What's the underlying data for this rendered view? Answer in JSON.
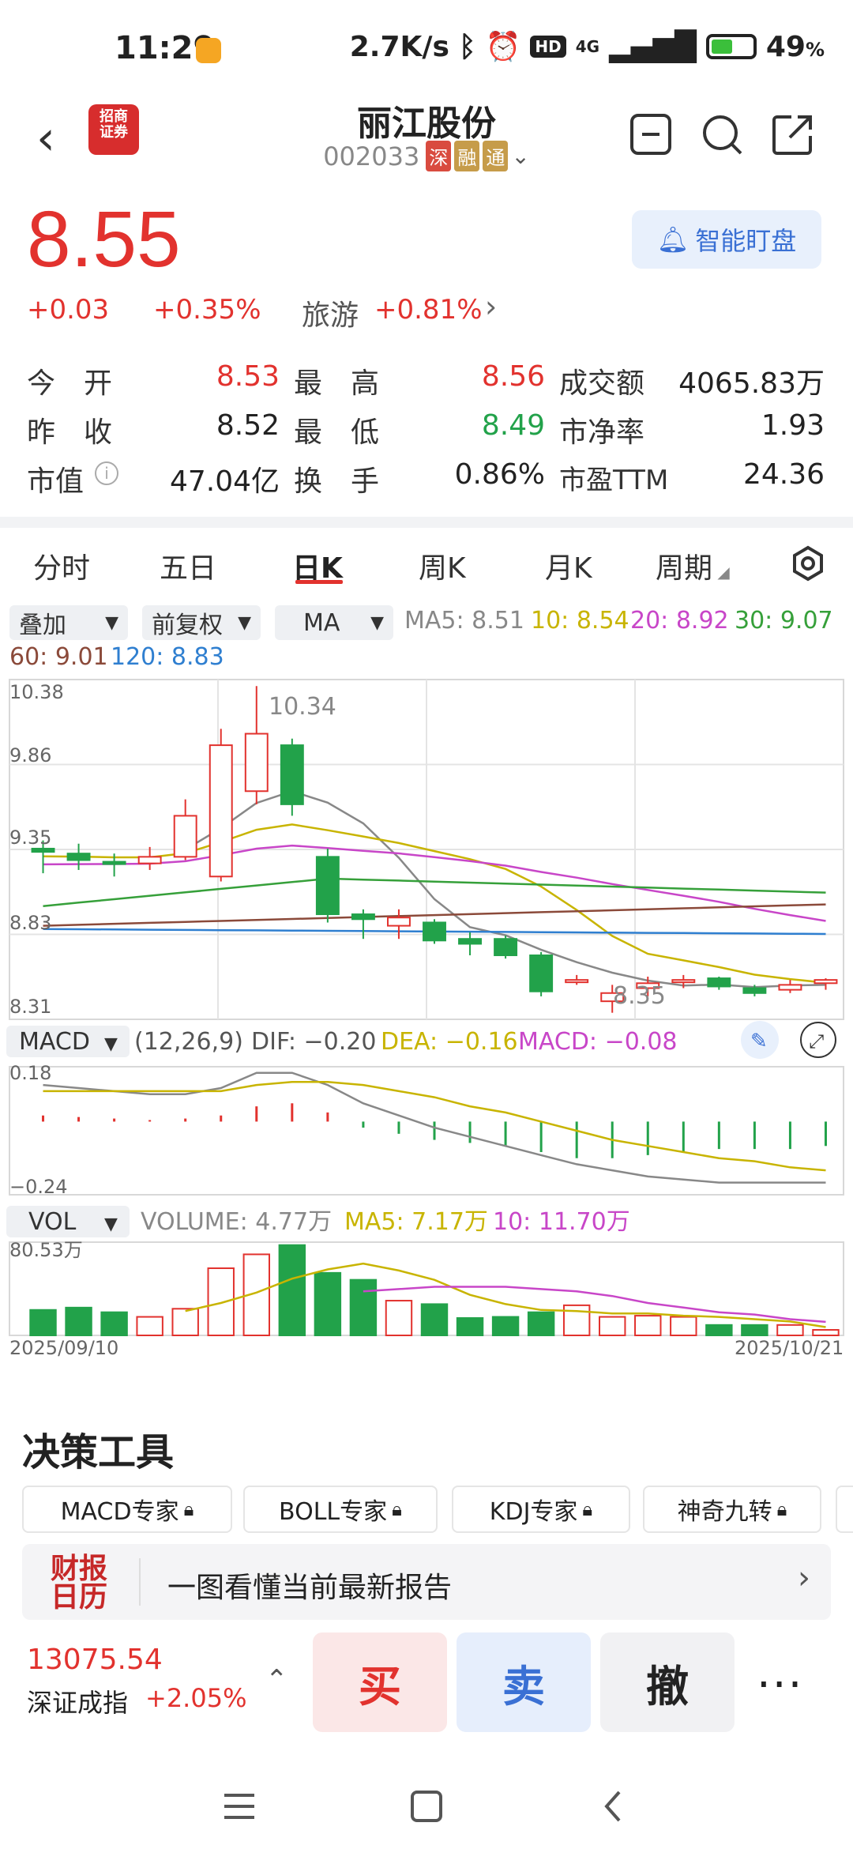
{
  "status": {
    "time": "11:29",
    "speed": "2.7K/s",
    "hd": "HD",
    "net": "4G",
    "battery": "49",
    "battery_pct": "%"
  },
  "header": {
    "name": "丽江股份",
    "code": "002033",
    "tags": [
      "深",
      "融",
      "通"
    ],
    "logo_text": "招商\n证券"
  },
  "price": {
    "last": "8.55",
    "change": "+0.03",
    "change_pct": "+0.35%",
    "sector": "旅游",
    "sector_pct": "+0.81%",
    "watch_label": "智能盯盘"
  },
  "stats": {
    "rows": [
      [
        {
          "label": "今　开",
          "value": "8.53",
          "color": "red"
        },
        {
          "label": "最　高",
          "value": "8.56",
          "color": "red"
        },
        {
          "label": "成交额",
          "value": "4065.83万",
          "color": "dark"
        }
      ],
      [
        {
          "label": "昨　收",
          "value": "8.52",
          "color": "dark"
        },
        {
          "label": "最　低",
          "value": "8.49",
          "color": "green"
        },
        {
          "label": "市净率",
          "value": "1.93",
          "color": "dark"
        }
      ],
      [
        {
          "label": "市值",
          "value": "47.04亿",
          "color": "dark"
        },
        {
          "label": "换　手",
          "value": "0.86%",
          "color": "dark"
        },
        {
          "label": "市盈TTM",
          "value": "24.36",
          "color": "dark"
        }
      ]
    ]
  },
  "tabs": [
    "分时",
    "五日",
    "日K",
    "周K",
    "月K",
    "周期"
  ],
  "selectors": {
    "overlay": "叠加",
    "adjust": "前复权",
    "ma": "MA"
  },
  "ma_values": {
    "ma5": "MA5: 8.51",
    "ma10": "10: 8.54",
    "ma20": "20: 8.92",
    "ma30": "30: 9.07",
    "ma60": "60: 9.01",
    "ma120": "120: 8.83"
  },
  "colors": {
    "red": "#e2322e",
    "green": "#22a24a",
    "ma5": "#888888",
    "ma10": "#c8b400",
    "ma20": "#c846c8",
    "ma30": "#36a03a",
    "ma60": "#8b4a3a",
    "ma120": "#2f7fd0"
  },
  "kline": {
    "y_labels": [
      "10.38",
      "9.86",
      "9.35",
      "8.83",
      "8.31"
    ],
    "high_label": "10.34",
    "low_label": "8.35",
    "ylim": [
      8.31,
      10.38
    ],
    "candles": [
      {
        "o": 9.35,
        "c": 9.33,
        "h": 9.4,
        "l": 9.2
      },
      {
        "o": 9.32,
        "c": 9.28,
        "h": 9.38,
        "l": 9.22
      },
      {
        "o": 9.27,
        "c": 9.26,
        "h": 9.32,
        "l": 9.18
      },
      {
        "o": 9.26,
        "c": 9.3,
        "h": 9.36,
        "l": 9.22
      },
      {
        "o": 9.3,
        "c": 9.55,
        "h": 9.65,
        "l": 9.28
      },
      {
        "o": 9.18,
        "c": 9.98,
        "h": 10.08,
        "l": 9.15
      },
      {
        "o": 9.7,
        "c": 10.05,
        "h": 10.34,
        "l": 9.62
      },
      {
        "o": 9.98,
        "c": 9.62,
        "h": 10.02,
        "l": 9.55
      },
      {
        "o": 9.3,
        "c": 8.95,
        "h": 9.35,
        "l": 8.9
      },
      {
        "o": 8.95,
        "c": 8.92,
        "h": 8.98,
        "l": 8.8
      },
      {
        "o": 8.88,
        "c": 8.93,
        "h": 8.98,
        "l": 8.8
      },
      {
        "o": 8.9,
        "c": 8.79,
        "h": 8.92,
        "l": 8.77
      },
      {
        "o": 8.8,
        "c": 8.77,
        "h": 8.84,
        "l": 8.7
      },
      {
        "o": 8.8,
        "c": 8.7,
        "h": 8.82,
        "l": 8.68
      },
      {
        "o": 8.7,
        "c": 8.48,
        "h": 8.72,
        "l": 8.45
      },
      {
        "o": 8.55,
        "c": 8.55,
        "h": 8.58,
        "l": 8.52
      },
      {
        "o": 8.42,
        "c": 8.47,
        "h": 8.52,
        "l": 8.35
      },
      {
        "o": 8.5,
        "c": 8.53,
        "h": 8.57,
        "l": 8.45
      },
      {
        "o": 8.54,
        "c": 8.55,
        "h": 8.58,
        "l": 8.5
      },
      {
        "o": 8.56,
        "c": 8.51,
        "h": 8.57,
        "l": 8.49
      },
      {
        "o": 8.5,
        "c": 8.47,
        "h": 8.52,
        "l": 8.45
      },
      {
        "o": 8.49,
        "c": 8.52,
        "h": 8.55,
        "l": 8.47
      },
      {
        "o": 8.53,
        "c": 8.55,
        "h": 8.56,
        "l": 8.49
      }
    ]
  },
  "macd": {
    "selector": "MACD",
    "params": "(12,26,9)",
    "dif": "DIF: −0.20",
    "dea": "DEA: −0.16",
    "macd": "MACD: −0.08",
    "y_labels": [
      "0.18",
      "−0.24"
    ],
    "ylim": [
      -0.24,
      0.18
    ],
    "bars": [
      0.02,
      0.015,
      0.01,
      0.005,
      0.01,
      0.02,
      0.05,
      0.06,
      0.03,
      -0.02,
      -0.04,
      -0.06,
      -0.07,
      -0.08,
      -0.1,
      -0.12,
      -0.12,
      -0.11,
      -0.1,
      -0.09,
      -0.09,
      -0.09,
      -0.08
    ],
    "dif_line": [
      0.12,
      0.11,
      0.1,
      0.09,
      0.09,
      0.11,
      0.16,
      0.16,
      0.12,
      0.06,
      0.02,
      -0.02,
      -0.05,
      -0.08,
      -0.11,
      -0.14,
      -0.16,
      -0.18,
      -0.19,
      -0.2,
      -0.2,
      -0.2,
      -0.2
    ],
    "dea_line": [
      0.1,
      0.1,
      0.1,
      0.1,
      0.1,
      0.1,
      0.12,
      0.13,
      0.13,
      0.12,
      0.1,
      0.08,
      0.05,
      0.03,
      0.0,
      -0.03,
      -0.06,
      -0.08,
      -0.1,
      -0.12,
      -0.13,
      -0.15,
      -0.16
    ]
  },
  "vol": {
    "selector": "VOL",
    "volume": "VOLUME: 4.77万",
    "ma5": "MA5: 7.17万",
    "ma10": "10: 11.70万",
    "y_label": "80.53万",
    "date_start": "2025/09/10",
    "date_end": "2025/10/21",
    "ymax": 80.53,
    "bars": [
      22,
      24,
      20,
      16,
      23,
      58,
      70,
      78,
      54,
      48,
      30,
      27,
      15,
      16,
      20,
      26,
      16,
      17,
      16,
      9,
      9,
      9,
      4.77
    ],
    "ma5_line": [
      null,
      null,
      null,
      null,
      21,
      28,
      37,
      49,
      57,
      62,
      56,
      48,
      35,
      27,
      22,
      21,
      19,
      19,
      17,
      16,
      14,
      12,
      7.17
    ],
    "ma10_line": [
      null,
      null,
      null,
      null,
      null,
      null,
      null,
      null,
      null,
      38,
      40,
      42,
      42,
      42,
      40,
      38,
      34,
      28,
      24,
      20,
      18,
      14,
      11.7
    ]
  },
  "tools": {
    "title": "决策工具",
    "chips": [
      "MACD专家",
      "BOLL专家",
      "KDJ专家",
      "神奇九转"
    ],
    "banner_logo": "财报\n日历",
    "banner_text": "一图看懂当前最新报告"
  },
  "bottom": {
    "index_value": "13075.54",
    "index_name": "深证成指",
    "index_chg": "+2.05%",
    "buy": "买",
    "sell": "卖",
    "cancel": "撤",
    "more": "···"
  }
}
